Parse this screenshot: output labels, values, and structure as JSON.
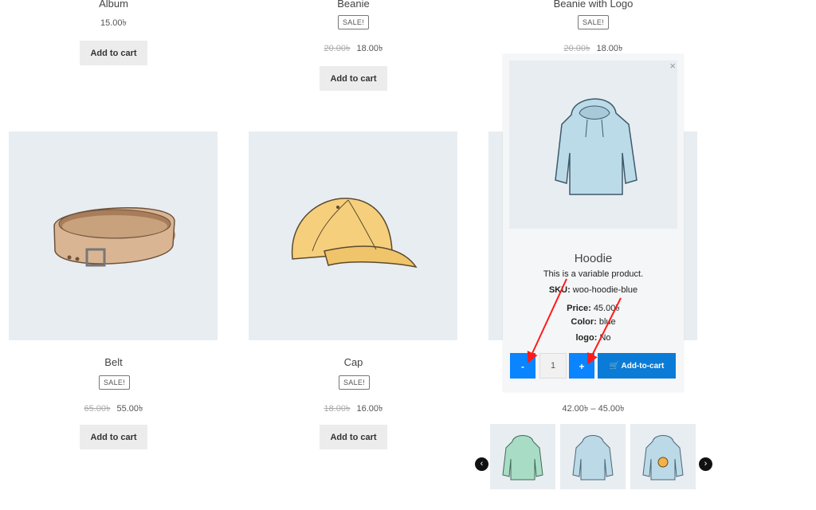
{
  "products_top": [
    {
      "name": "Album",
      "price": "15.00৳",
      "button": "Add to cart"
    },
    {
      "name": "Beanie",
      "sale": "SALE!",
      "old_price": "20.00৳",
      "price": "18.00৳",
      "button": "Add to cart"
    },
    {
      "name": "Beanie with Logo",
      "sale": "SALE!",
      "old_price": "20.00৳",
      "price": "18.00৳"
    }
  ],
  "products_middle": [
    {
      "name": "Belt",
      "sale": "SALE!",
      "old_price": "65.00৳",
      "price": "55.00৳",
      "button": "Add to cart"
    },
    {
      "name": "Cap",
      "sale": "SALE!",
      "old_price": "18.00৳",
      "price": "16.00৳",
      "button": "Add to cart"
    },
    {
      "price_range": "42.00৳ – 45.00৳"
    }
  ],
  "popup": {
    "close": "×",
    "title": "Hoodie",
    "description": "This is a variable product.",
    "sku_label": "SKU:",
    "sku": "woo-hoodie-blue",
    "price_label": "Price:",
    "price": "45.00৳",
    "color_label": "Color:",
    "color": "blue",
    "logo_label": "logo:",
    "logo": "No",
    "minus": "-",
    "qty": "1",
    "plus": "+",
    "add_to_cart": "Add-to-cart",
    "accent": "#0a84ff"
  },
  "gallery": {
    "prev": "‹",
    "next": "›"
  }
}
